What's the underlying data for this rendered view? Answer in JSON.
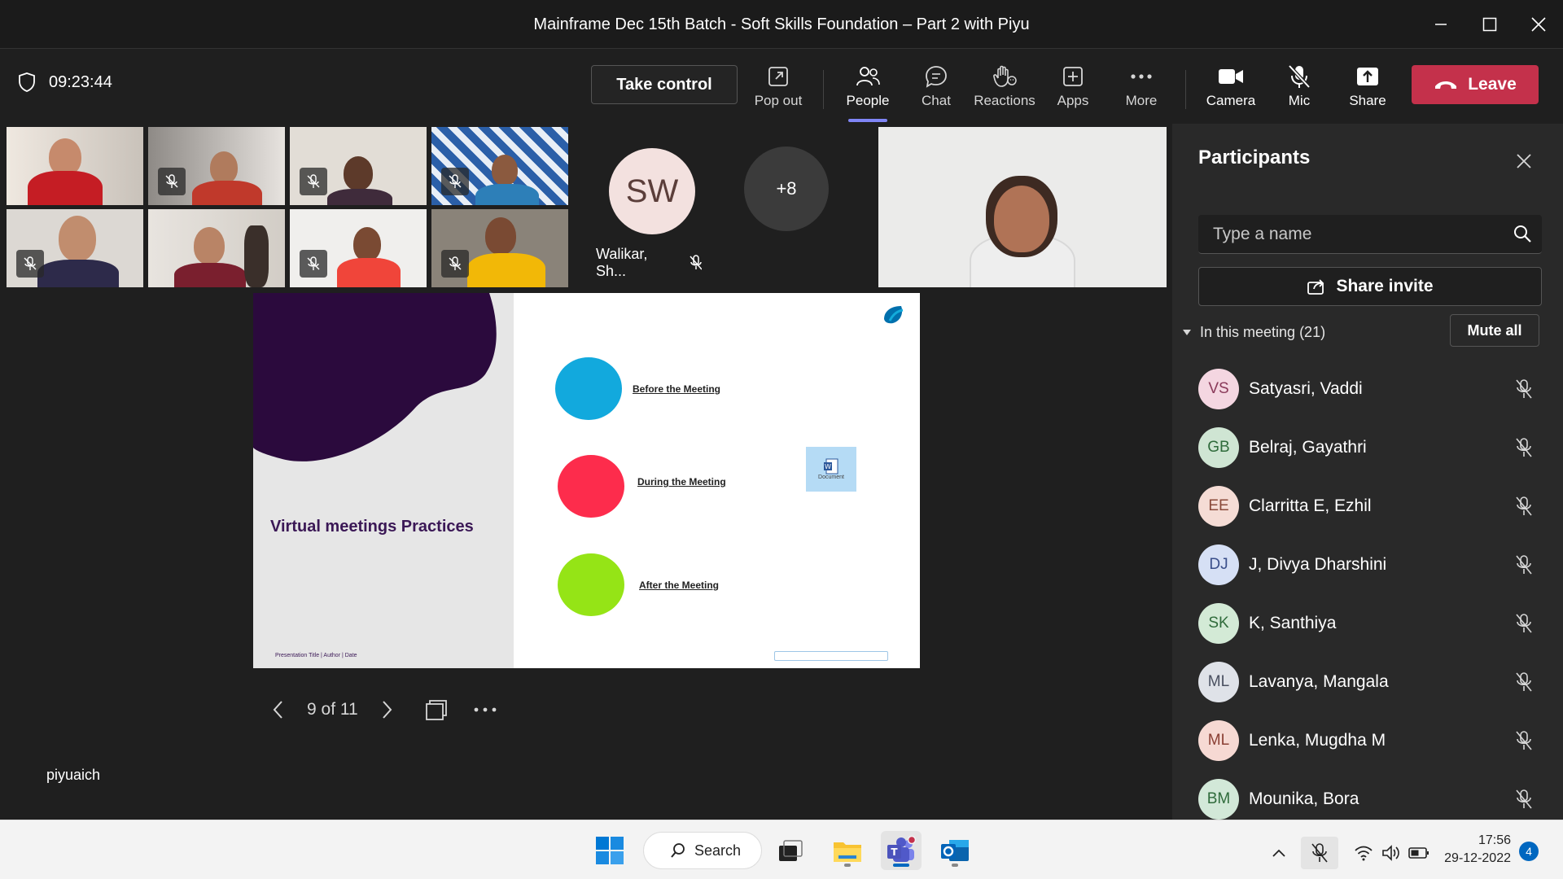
{
  "window": {
    "title": "Mainframe Dec 15th Batch - Soft Skills Foundation – Part 2 with Piyu"
  },
  "toolbar": {
    "timer": "09:23:44",
    "take_control": "Take control",
    "pop_out": "Pop out",
    "people": "People",
    "chat": "Chat",
    "reactions": "Reactions",
    "apps": "Apps",
    "more": "More",
    "camera": "Camera",
    "mic": "Mic",
    "share": "Share",
    "leave": "Leave"
  },
  "stage": {
    "avatar_initials": "SW",
    "avatar_name": "Walikar, Sh...",
    "overflow_count": "+8",
    "presenter_name": "piyuaich"
  },
  "slide": {
    "title": "Virtual meetings Practices",
    "footer": "Presentation Title | Author | Date",
    "items": [
      {
        "label": "Before the Meeting",
        "color": "#12a9dd"
      },
      {
        "label": "During the Meeting",
        "color": "#fd2c4c"
      },
      {
        "label": "After the Meeting",
        "color": "#95e416"
      }
    ],
    "doc_label": "Document",
    "page_indicator": "9 of 11"
  },
  "panel": {
    "title": "Participants",
    "search_placeholder": "Type a name",
    "share_invite": "Share invite",
    "section_label": "In this meeting (21)",
    "mute_all": "Mute all",
    "participants": [
      {
        "initials": "VS",
        "name": "Satyasri, Vaddi",
        "bg": "#f4d6e1",
        "fg": "#8a3a5a"
      },
      {
        "initials": "GB",
        "name": "Belraj, Gayathri",
        "bg": "#cfe5d3",
        "fg": "#2f6b3b"
      },
      {
        "initials": "EE",
        "name": "Clarritta E, Ezhil",
        "bg": "#f5dcd5",
        "fg": "#8a4a3a"
      },
      {
        "initials": "DJ",
        "name": "J, Divya Dharshini",
        "bg": "#d6e0f5",
        "fg": "#3a4f8a"
      },
      {
        "initials": "SK",
        "name": "K, Santhiya",
        "bg": "#d3ead6",
        "fg": "#2f6b3b"
      },
      {
        "initials": "ML",
        "name": "Lavanya, Mangala",
        "bg": "#dfe2e8",
        "fg": "#4a5060"
      },
      {
        "initials": "ML",
        "name": "Lenka, Mugdha M",
        "bg": "#f6d9d3",
        "fg": "#8a3f34"
      },
      {
        "initials": "BM",
        "name": "Mounika, Bora",
        "bg": "#d2e8d8",
        "fg": "#2f6b3b"
      }
    ]
  },
  "taskbar": {
    "search": "Search",
    "time": "17:56",
    "date": "29-12-2022",
    "notifications": "4"
  }
}
